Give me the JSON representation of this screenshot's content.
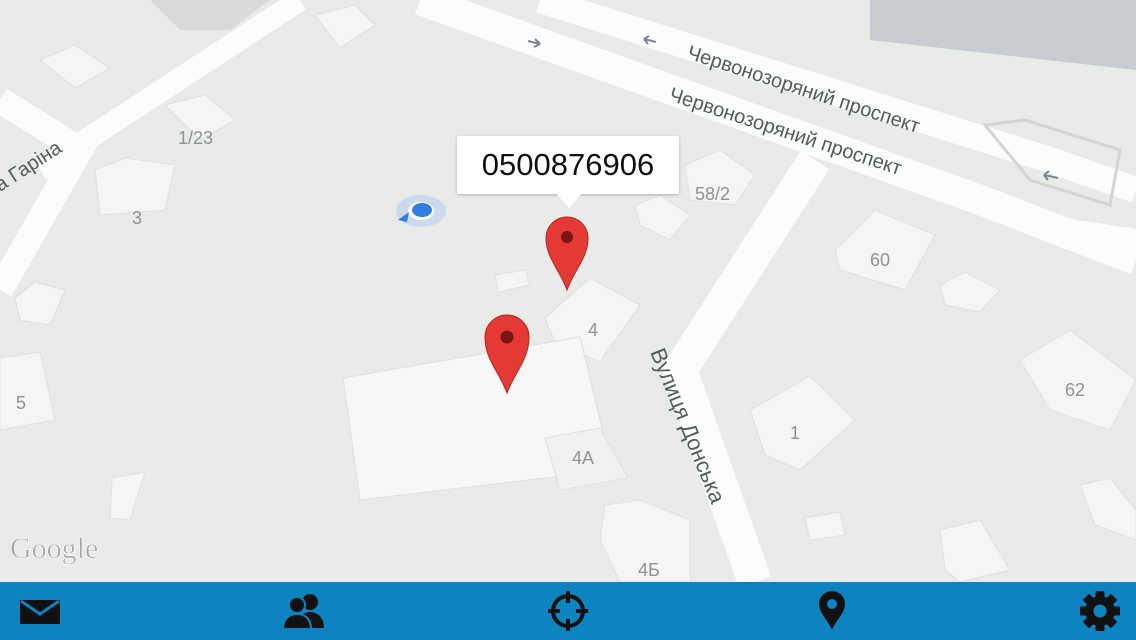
{
  "map": {
    "streets": {
      "prospekt_upper": "Червонозоряний проспект",
      "prospekt_lower": "Червонозоряний проспект",
      "donska": "Вулиця Донська",
      "garina": "а Гаріна"
    },
    "buildings": [
      "1/23",
      "3",
      "58/2",
      "60",
      "4",
      "5",
      "62",
      "1",
      "4А",
      "4Б"
    ],
    "watermark": "Google",
    "colors": {
      "ground": "#e9ebe9",
      "road": "#fbfcfc",
      "building": "#f5f6f5",
      "pin": "#e53935",
      "location_dot": "#2f7de1"
    }
  },
  "marker_callout": {
    "text": "0500876906"
  },
  "bottom_nav": {
    "background": "#0d84bf",
    "items": [
      {
        "icon": "envelope-icon"
      },
      {
        "icon": "contacts-icon"
      },
      {
        "icon": "crosshair-icon"
      },
      {
        "icon": "map-pin-icon"
      },
      {
        "icon": "gear-icon"
      }
    ]
  }
}
